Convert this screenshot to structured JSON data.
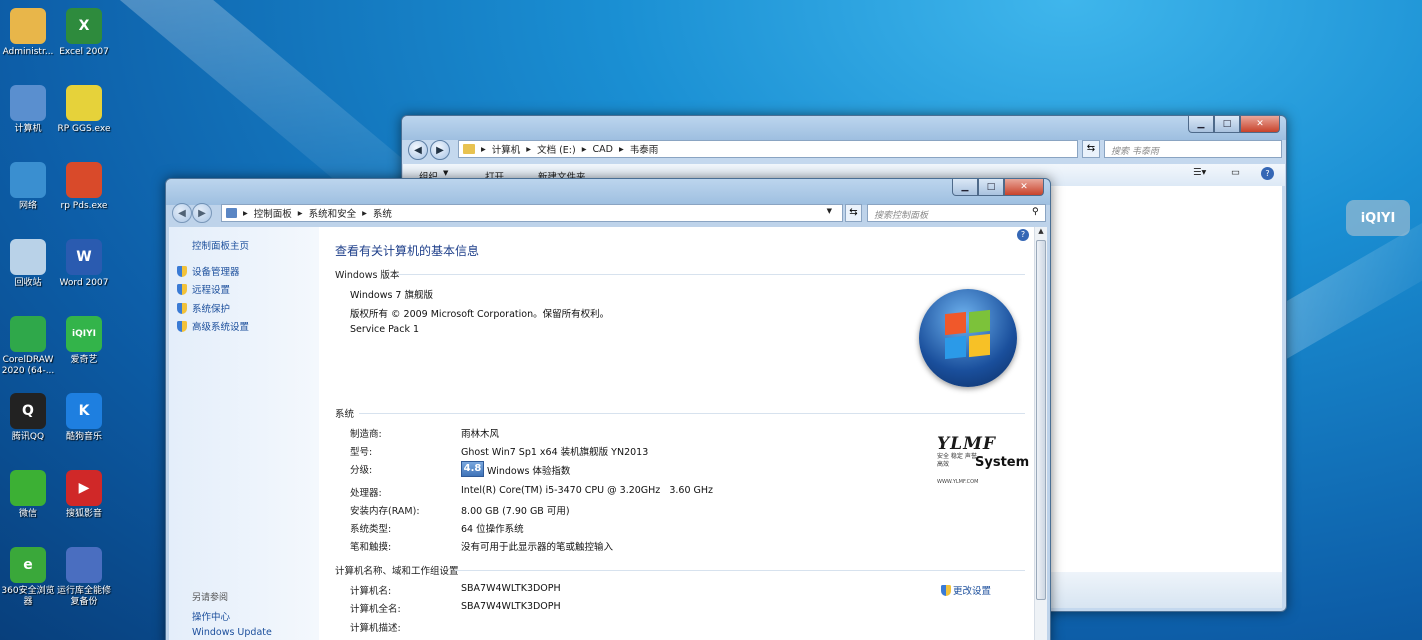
{
  "desktop": {
    "icons": [
      {
        "label": "Administr...",
        "icon": "folder-icon",
        "color": "#e8b64a",
        "glyph": ""
      },
      {
        "label": "Excel 2007",
        "icon": "excel-icon",
        "color": "#2e8b3d",
        "glyph": "X"
      },
      {
        "label": "计算机",
        "icon": "computer-icon",
        "color": "#5a8fcf",
        "glyph": ""
      },
      {
        "label": "RP GGS.exe",
        "icon": "exe-icon",
        "color": "#e6d23a",
        "glyph": ""
      },
      {
        "label": "网络",
        "icon": "network-icon",
        "color": "#3a8fd0",
        "glyph": ""
      },
      {
        "label": "rp Pds.exe",
        "icon": "exe-icon",
        "color": "#d94a2a",
        "glyph": ""
      },
      {
        "label": "回收站",
        "icon": "recycle-bin-icon",
        "color": "#b9d2e8",
        "glyph": ""
      },
      {
        "label": "Word 2007",
        "icon": "word-icon",
        "color": "#2a5bb0",
        "glyph": "W"
      },
      {
        "label": "CorelDRAW 2020 (64-...",
        "icon": "coreldraw-icon",
        "color": "#2fa84a",
        "glyph": ""
      },
      {
        "label": "爱奇艺",
        "icon": "iqiyi-icon",
        "color": "#33b44a",
        "glyph": "iQIYI"
      },
      {
        "label": "腾讯QQ",
        "icon": "qq-icon",
        "color": "#222222",
        "glyph": "Q"
      },
      {
        "label": "酷狗音乐",
        "icon": "kugou-icon",
        "color": "#1e7fe0",
        "glyph": "K"
      },
      {
        "label": "微信",
        "icon": "wechat-icon",
        "color": "#3cb034",
        "glyph": ""
      },
      {
        "label": "搜狐影音",
        "icon": "sohu-video-icon",
        "color": "#d02828",
        "glyph": "▶"
      },
      {
        "label": "360安全浏览器",
        "icon": "360-browser-icon",
        "color": "#3aa83a",
        "glyph": "e"
      },
      {
        "label": "运行库全能修复备份",
        "icon": "repair-tool-icon",
        "color": "#4a6ec0",
        "glyph": ""
      }
    ],
    "watermark": "iQIYI"
  },
  "explorer": {
    "breadcrumb": [
      "计算机",
      "文档 (E:)",
      "CAD",
      "韦泰雨"
    ],
    "search_placeholder": "搜索 韦泰雨",
    "toolbar": {
      "organize": "组织",
      "open": "打开",
      "new_folder": "新建文件夹"
    }
  },
  "system": {
    "breadcrumb": [
      "控制面板",
      "系统和安全",
      "系统"
    ],
    "search_placeholder": "搜索控制面板",
    "sidebar": {
      "home": "控制面板主页",
      "items": [
        "设备管理器",
        "远程设置",
        "系统保护",
        "高级系统设置"
      ],
      "see_also_title": "另请参阅",
      "see_also": [
        "操作中心",
        "Windows Update"
      ]
    },
    "title": "查看有关计算机的基本信息",
    "edition_header": "Windows 版本",
    "edition": [
      "Windows 7 旗舰版",
      "版权所有 © 2009 Microsoft Corporation。保留所有权利。",
      "Service Pack 1"
    ],
    "system_header": "系统",
    "system_rows": [
      {
        "label": "制造商:",
        "value": "雨林木风"
      },
      {
        "label": "型号:",
        "value": "Ghost Win7 Sp1 x64 装机旗舰版 YN2013"
      },
      {
        "label": "分级:",
        "value": "Windows 体验指数",
        "score": "4.8"
      },
      {
        "label": "处理器:",
        "value": "Intel(R) Core(TM) i5-3470 CPU @ 3.20GHz   3.60 GHz"
      },
      {
        "label": "安装内存(RAM):",
        "value": "8.00 GB (7.90 GB 可用)"
      },
      {
        "label": "系统类型:",
        "value": "64 位操作系统"
      },
      {
        "label": "笔和触摸:",
        "value": "没有可用于此显示器的笔或触控输入"
      }
    ],
    "computer_header": "计算机名称、域和工作组设置",
    "computer_rows": [
      {
        "label": "计算机名:",
        "value": "SBA7W4WLTK3DOPH"
      },
      {
        "label": "计算机全名:",
        "value": "SBA7W4WLTK3DOPH"
      },
      {
        "label": "计算机描述:",
        "value": ""
      }
    ],
    "change_settings": "更改设置",
    "oem_logo": {
      "line1": "YLMF",
      "line2": "安全 稳定 声誉 高效",
      "line3": "System",
      "line4": "WWW.YLMF.COM"
    }
  }
}
